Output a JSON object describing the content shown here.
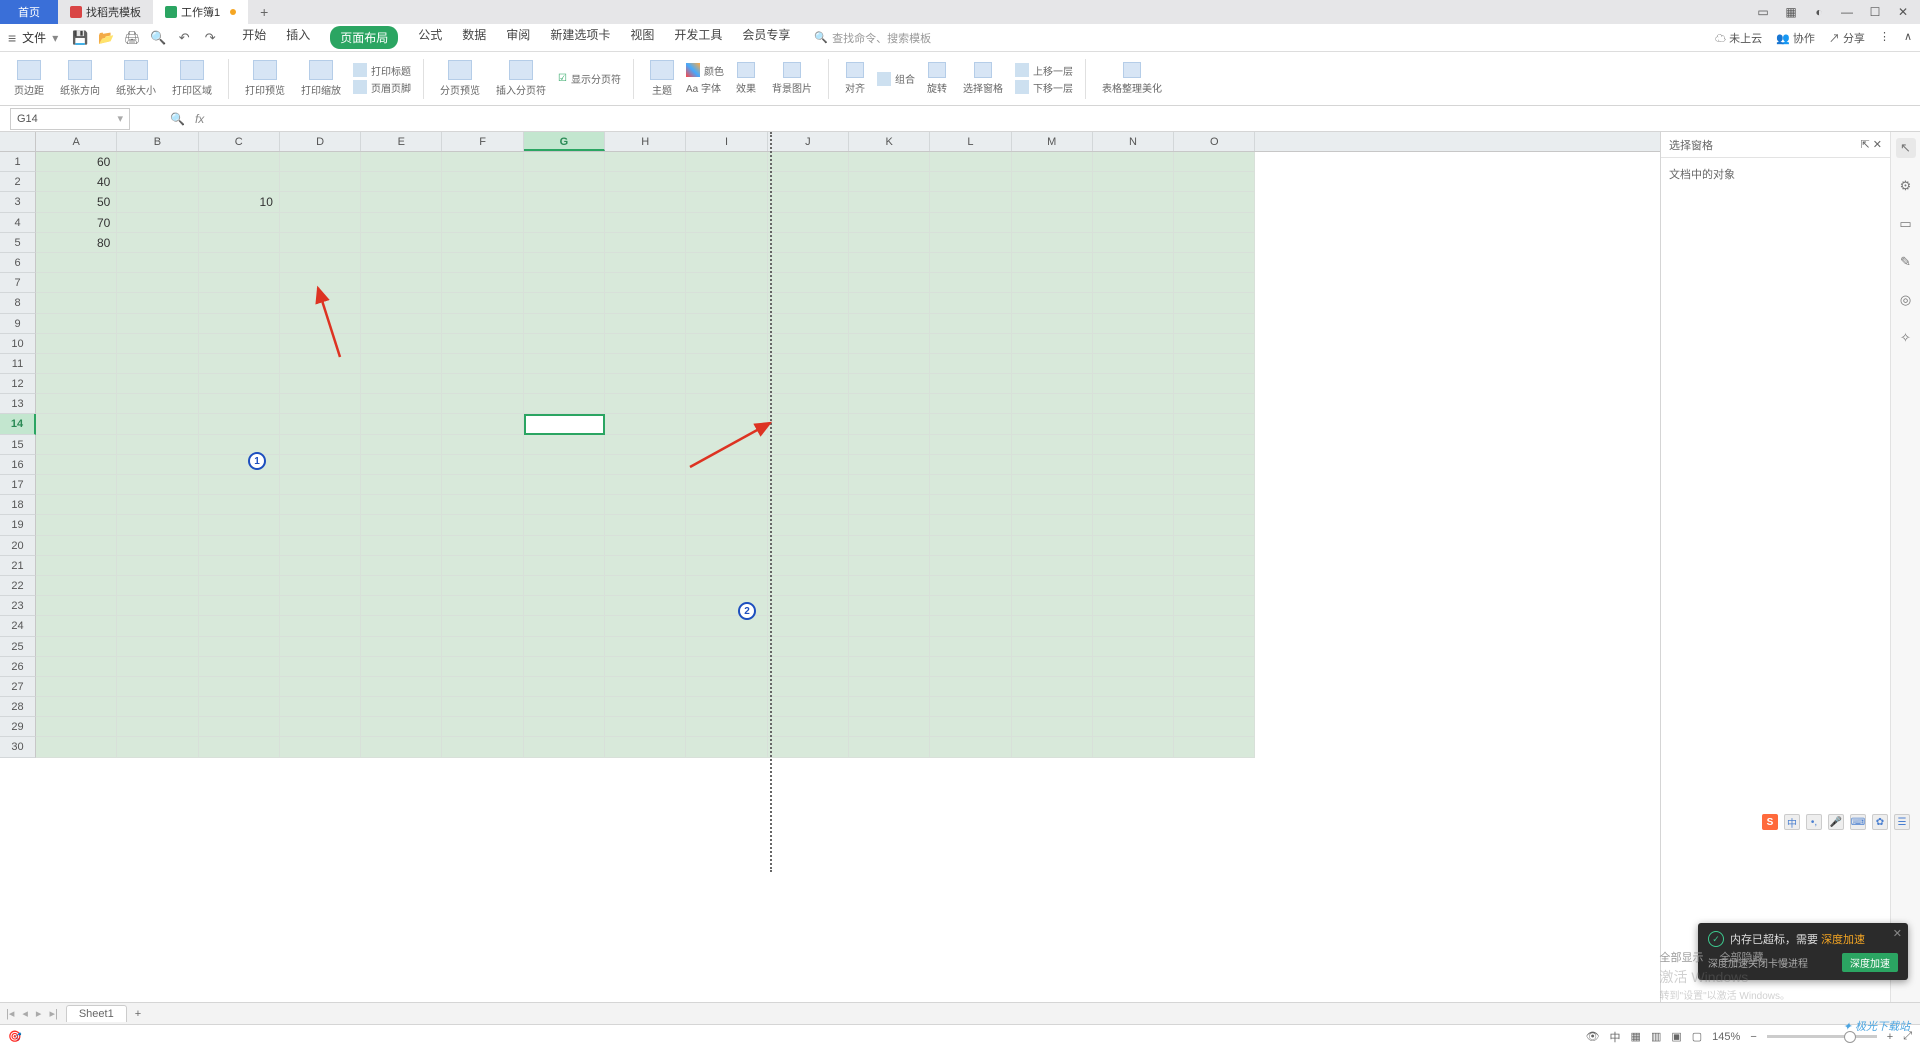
{
  "tabs": {
    "home": "首页",
    "template": "找稻壳模板",
    "workbook": "工作簿1"
  },
  "menu": {
    "file": "文件",
    "items": [
      "开始",
      "插入",
      "页面布局",
      "公式",
      "数据",
      "审阅",
      "新建选项卡",
      "视图",
      "开发工具",
      "会员专享"
    ],
    "active_index": 2,
    "search_placeholder": "查找命令、搜索模板"
  },
  "menu_right": {
    "cloud": "未上云",
    "coop": "协作",
    "share": "分享"
  },
  "ribbon": {
    "g1": "页边距",
    "g2": "纸张方向",
    "g3": "纸张大小",
    "g4": "打印区域",
    "g5": "打印预览",
    "g6": "打印缩放",
    "m1": "打印标题",
    "m2": "页眉页脚",
    "g7": "分页预览",
    "g8": "插入分页符",
    "m3": "显示分页符",
    "g9": "主题",
    "g10": "Aa 字体",
    "m4": "颜色",
    "g11": "效果",
    "g12": "背景图片",
    "g13": "对齐",
    "m5": "组合",
    "g14": "旋转",
    "g15": "选择窗格",
    "m6": "上移一层",
    "m7": "下移一层",
    "g16": "表格整理美化"
  },
  "cell_ref": "G14",
  "side_pane": {
    "title": "选择窗格",
    "sub": "文档中的对象"
  },
  "sheet": {
    "columns": [
      "A",
      "B",
      "C",
      "D",
      "E",
      "F",
      "G",
      "H",
      "I",
      "J",
      "K",
      "L",
      "M",
      "N",
      "O"
    ],
    "rows": 30,
    "active_col": "G",
    "active_row": 14,
    "data": {
      "A1": "60",
      "A2": "40",
      "A3": "50",
      "A4": "70",
      "A5": "80",
      "C3": "10"
    }
  },
  "annotations": {
    "badge1": "1",
    "badge2": "2"
  },
  "sheet_tab": "Sheet1",
  "toast": {
    "title_a": "内存已超标，需要",
    "title_b": "深度加速",
    "sub": "深度加速关闭卡慢进程",
    "btn": "深度加速"
  },
  "watermark": {
    "l1": "激活 Windows",
    "l2": "转到\"设置\"以激活 Windows。",
    "alt1": "全部显示",
    "alt2": "全部隐藏"
  },
  "status": {
    "zoom": "145%"
  },
  "logo": "极光下载站"
}
